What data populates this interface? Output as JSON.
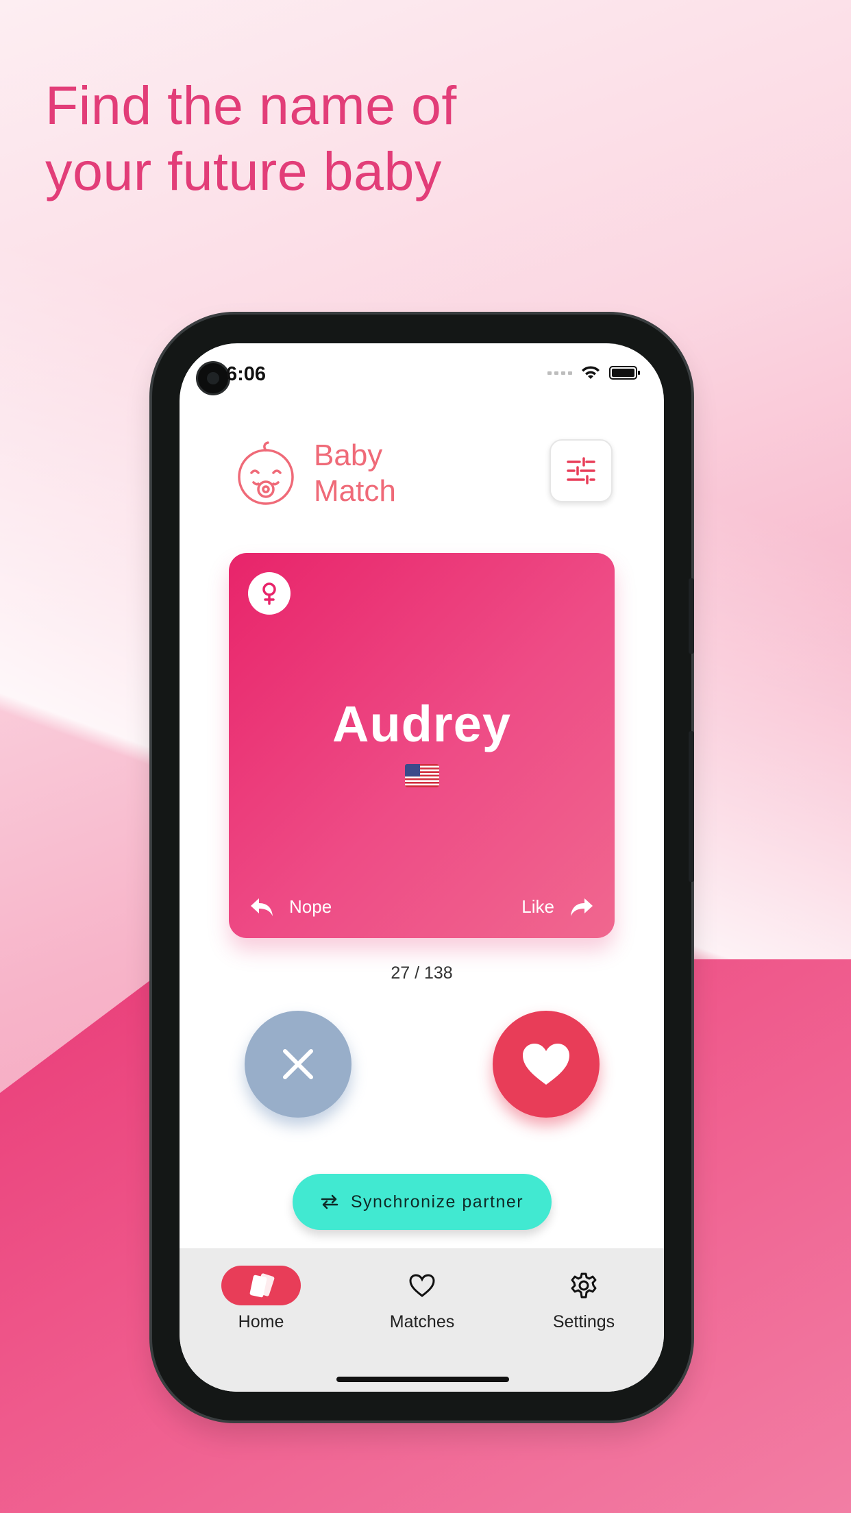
{
  "hero": {
    "title_line1": "Find the name of",
    "title_line2": "your future baby"
  },
  "status_bar": {
    "time": "6:06"
  },
  "header": {
    "app_name_line1": "Baby",
    "app_name_line2": "Match",
    "logo_icon": "baby-face-icon",
    "filter_icon": "sliders-icon"
  },
  "card": {
    "gender_icon": "female-icon",
    "name": "Audrey",
    "origin_flag": "us-flag-icon",
    "nope_label": "Nope",
    "like_label": "Like"
  },
  "counter": "27 / 138",
  "actions": {
    "nope_icon": "close-icon",
    "like_icon": "heart-icon"
  },
  "sync_button": {
    "label": "Synchronize partner",
    "icon": "swap-arrows-icon"
  },
  "bottom_nav": {
    "items": [
      {
        "label": "Home",
        "icon": "cards-icon",
        "active": true
      },
      {
        "label": "Matches",
        "icon": "heart-outline-icon",
        "active": false
      },
      {
        "label": "Settings",
        "icon": "gear-icon",
        "active": false
      }
    ]
  },
  "colors": {
    "brand_pink": "#e23d78",
    "card_start": "#e8246a",
    "card_end": "#f0678f",
    "like_red": "#e83d58",
    "nope_blue": "#98aec9",
    "sync_teal": "#41e9d1",
    "logo_coral": "#ef6a78"
  }
}
